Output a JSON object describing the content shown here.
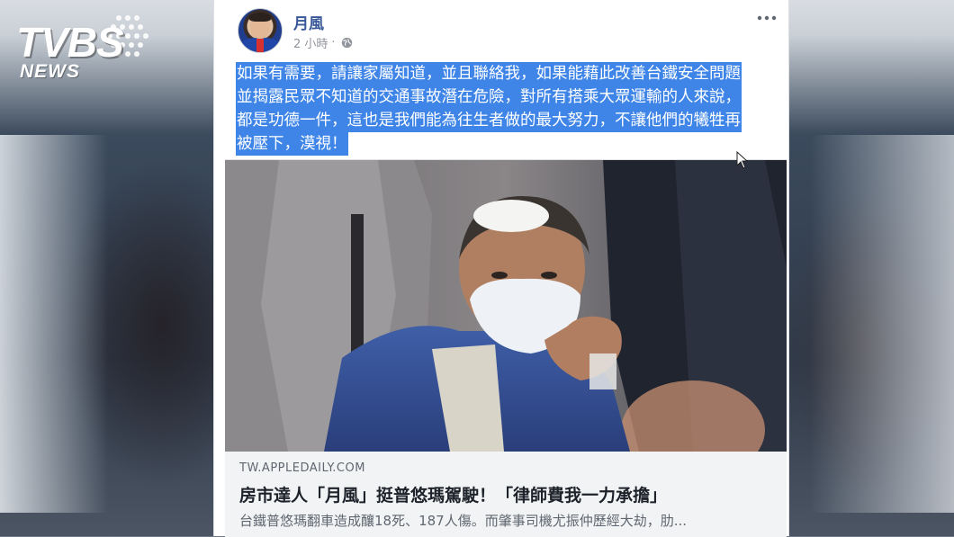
{
  "broadcaster": {
    "logo_main": "TVBS",
    "logo_sub": "NEWS"
  },
  "post": {
    "author": "月風",
    "timestamp": "2 小時",
    "privacy_icon": "globe-icon",
    "more_icon": "more-icon",
    "text_lines": [
      "如果有需要，請讓家屬知道，並且聯絡我，如果能藉此改善台鐵安全問題",
      "並揭露民眾不知道的交通事故潛在危險，對所有搭乘大眾運輸的人來說，",
      "都是功德一件，這也是我們能為往生者做的最大努力，不讓他們的犧牲再",
      "被壓下，漠視！"
    ],
    "highlight_color": "#3f85e8"
  },
  "link": {
    "domain": "TW.APPLEDAILY.COM",
    "headline": "房市達人「月風」挺普悠瑪駕駛！「律師費我一力承擔」",
    "description": "台鐵普悠瑪翻車造成釀18死、187人傷。而肇事司機尤振仲歷經大劫，肋..."
  },
  "colors": {
    "author_link": "#385898",
    "meta_gray": "#90949c",
    "preview_bg": "#f2f3f5"
  }
}
